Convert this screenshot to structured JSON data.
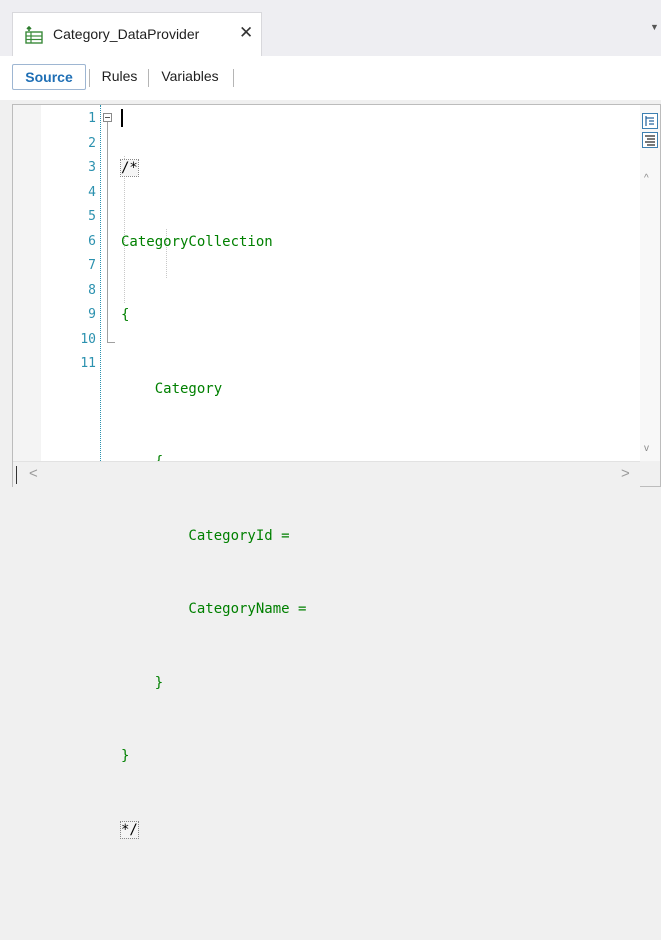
{
  "document_tab": {
    "title": "Category_DataProvider",
    "close_glyph": "✕",
    "icon": "data-provider-icon",
    "overflow_glyph": "▼"
  },
  "editor_tabs": [
    {
      "label": "Source",
      "active": true
    },
    {
      "label": "Rules",
      "active": false
    },
    {
      "label": "Variables",
      "active": false
    }
  ],
  "editor": {
    "line_numbers": [
      "1",
      "2",
      "3",
      "4",
      "5",
      "6",
      "7",
      "8",
      "9",
      "10",
      "11"
    ],
    "lines": [
      "/*",
      "CategoryCollection",
      "{",
      "    Category",
      "    {",
      "        CategoryId =",
      "        CategoryName =",
      "    }",
      "}",
      "*/",
      ""
    ]
  },
  "scrollbar": {
    "outline_button_icon": "outline-icon",
    "wrap_button_icon": "text-align-icon",
    "up_glyph": "^",
    "down_glyph": "v",
    "left_glyph": "<",
    "right_glyph": ">"
  },
  "colors": {
    "line_number": "#2b91af",
    "code_text": "#008000",
    "active_tab": "#1f6fb5",
    "button_border": "#3c7fb1"
  }
}
